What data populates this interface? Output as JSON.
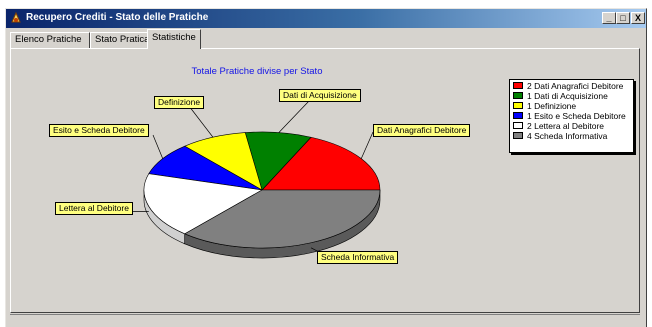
{
  "window": {
    "title": "Recupero Crediti - Stato delle Pratiche",
    "controls": {
      "minimize": "_",
      "maximize": "□",
      "close": "X"
    }
  },
  "tabs": [
    {
      "label": "Elenco Pratiche",
      "active": false
    },
    {
      "label": "Stato Pratica",
      "active": false
    },
    {
      "label": "Statistiche",
      "active": true
    }
  ],
  "chart_data": {
    "type": "pie",
    "title": "Totale Pratiche divise per Stato",
    "style": "3d",
    "legend_position": "right",
    "slices": [
      {
        "label": "Dati Anagrafici Debitore",
        "value": 2,
        "color": "#ff0000"
      },
      {
        "label": "Dati di Acquisizione",
        "value": 1,
        "color": "#008000"
      },
      {
        "label": "Definizione",
        "value": 1,
        "color": "#ffff00"
      },
      {
        "label": "Esito e Scheda Debitore",
        "value": 1,
        "color": "#0000ff"
      },
      {
        "label": "Lettera al Debitore",
        "value": 2,
        "color": "#ffffff"
      },
      {
        "label": "Scheda Informativa",
        "value": 4,
        "color": "#808080"
      }
    ]
  },
  "legend": [
    "2 Dati Anagrafici Debitore",
    "1 Dati di Acquisizione",
    "1 Definizione",
    "1 Esito e Scheda Debitore",
    "2 Lettera al Debitore",
    "4 Scheda Informativa"
  ]
}
